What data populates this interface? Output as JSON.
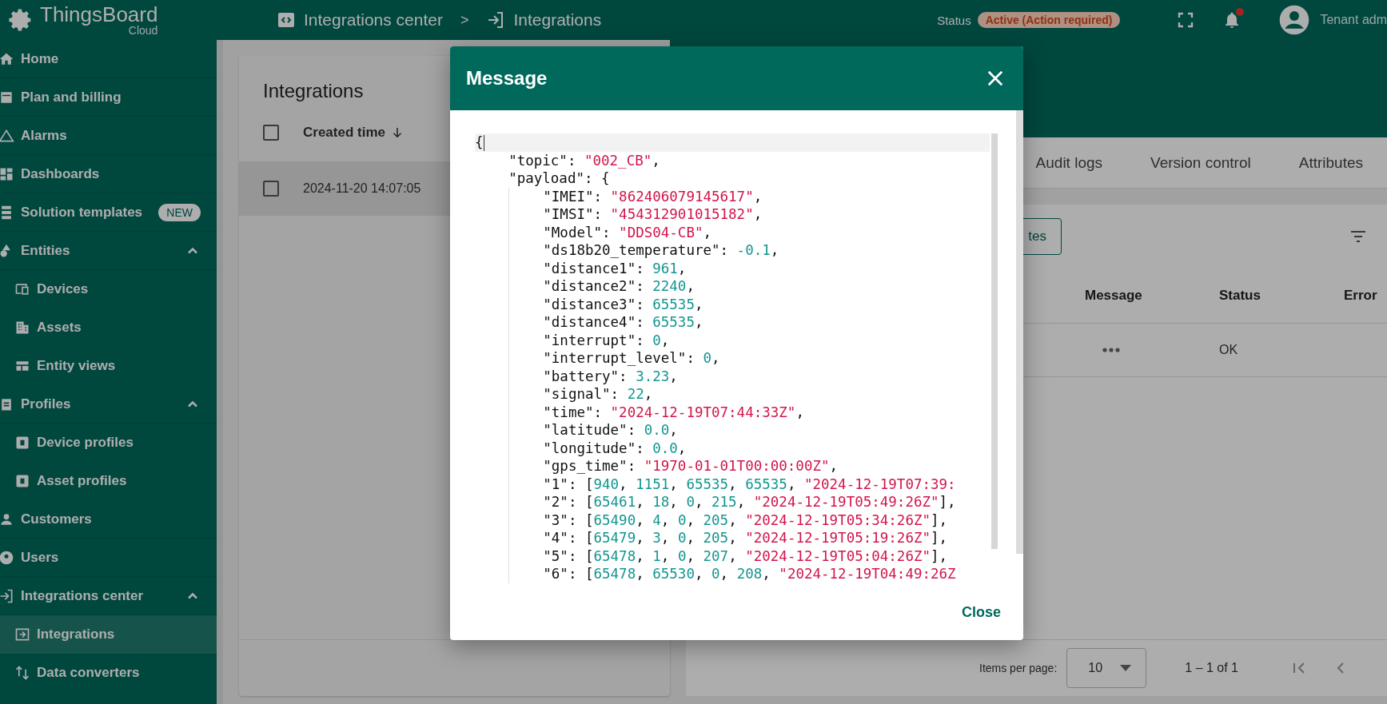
{
  "top_bar": {
    "logo": "ThingsBoard",
    "logo_sub": "Cloud",
    "breadcrumbs": [
      {
        "label": "Integrations center"
      },
      {
        "label": "Integrations"
      }
    ],
    "separator": ">",
    "status_label": "Status",
    "status_badge": "Active (Action required)",
    "notifications_unread": true,
    "user_role": "Tenant adm"
  },
  "sidebar": {
    "items": [
      {
        "label": "Home",
        "selected": false
      },
      {
        "label": "Plan and billing",
        "selected": false
      },
      {
        "label": "Alarms",
        "selected": false
      },
      {
        "label": "Dashboards",
        "selected": false
      },
      {
        "label": "Solution templates",
        "badge": "NEW",
        "selected": false
      },
      {
        "label": "Entities",
        "selected": false,
        "expanded": true,
        "children": [
          {
            "label": "Devices",
            "selected": false
          },
          {
            "label": "Assets",
            "selected": false
          },
          {
            "label": "Entity views",
            "selected": false
          }
        ]
      },
      {
        "label": "Profiles",
        "selected": false,
        "expanded": true,
        "children": [
          {
            "label": "Device profiles",
            "selected": false
          },
          {
            "label": "Asset profiles",
            "selected": false
          }
        ]
      },
      {
        "label": "Customers",
        "selected": false
      },
      {
        "label": "Users",
        "selected": false
      },
      {
        "label": "Integrations center",
        "selected": false,
        "expanded": true,
        "children": [
          {
            "label": "Integrations",
            "selected": true
          },
          {
            "label": "Data converters",
            "selected": false
          }
        ]
      }
    ]
  },
  "integrations_card": {
    "title": "Integrations",
    "header_checked": false,
    "columns": [
      {
        "label": "Created time",
        "sort_descending": true
      }
    ],
    "rows": [
      {
        "created_time": "2024-11-20 14:07:05",
        "checked": false,
        "selected": true
      }
    ]
  },
  "details_panel": {
    "tabs": [
      {
        "label": "Audit logs",
        "selected": false
      },
      {
        "label": "Version control",
        "selected": false
      },
      {
        "label": "Attributes",
        "selected": false
      }
    ],
    "toolbar_button": "tes",
    "columns": [
      "Message",
      "Status",
      "Error"
    ],
    "rows": [
      {
        "status": "OK"
      }
    ],
    "items_per_page_label": "Items per page:",
    "page_size": "10",
    "range": "1 – 1 of 1"
  },
  "dialog": {
    "title": "Message",
    "close_button": "Close",
    "code": [
      {
        "current": true,
        "tokens": [
          {
            "kind": "plain",
            "text": "{"
          }
        ],
        "children": [
          {
            "current": false,
            "tokens": [
              {
                "kind": "plain",
                "text": "\"topic\": "
              },
              {
                "kind": "string",
                "text": "\"002_CB\""
              },
              {
                "kind": "plain",
                "text": ","
              }
            ]
          },
          {
            "current": false,
            "tokens": [
              {
                "kind": "plain",
                "text": "\"payload\": {"
              }
            ],
            "children": [
              {
                "current": false,
                "tokens": [
                  {
                    "kind": "plain",
                    "text": "\"IMEI\": "
                  },
                  {
                    "kind": "string",
                    "text": "\"862406079145617\""
                  },
                  {
                    "kind": "plain",
                    "text": ","
                  }
                ]
              },
              {
                "current": false,
                "tokens": [
                  {
                    "kind": "plain",
                    "text": "\"IMSI\": "
                  },
                  {
                    "kind": "string",
                    "text": "\"454312901015182\""
                  },
                  {
                    "kind": "plain",
                    "text": ","
                  }
                ]
              },
              {
                "current": false,
                "tokens": [
                  {
                    "kind": "plain",
                    "text": "\"Model\": "
                  },
                  {
                    "kind": "string",
                    "text": "\"DDS04-CB\""
                  },
                  {
                    "kind": "plain",
                    "text": ","
                  }
                ]
              },
              {
                "current": false,
                "tokens": [
                  {
                    "kind": "plain",
                    "text": "\"ds18b20_temperature\": "
                  },
                  {
                    "kind": "number",
                    "text": "-0.1"
                  },
                  {
                    "kind": "plain",
                    "text": ","
                  }
                ]
              },
              {
                "current": false,
                "tokens": [
                  {
                    "kind": "plain",
                    "text": "\"distance1\": "
                  },
                  {
                    "kind": "number",
                    "text": "961"
                  },
                  {
                    "kind": "plain",
                    "text": ","
                  }
                ]
              },
              {
                "current": false,
                "tokens": [
                  {
                    "kind": "plain",
                    "text": "\"distance2\": "
                  },
                  {
                    "kind": "number",
                    "text": "2240"
                  },
                  {
                    "kind": "plain",
                    "text": ","
                  }
                ]
              },
              {
                "current": false,
                "tokens": [
                  {
                    "kind": "plain",
                    "text": "\"distance3\": "
                  },
                  {
                    "kind": "number",
                    "text": "65535"
                  },
                  {
                    "kind": "plain",
                    "text": ","
                  }
                ]
              },
              {
                "current": false,
                "tokens": [
                  {
                    "kind": "plain",
                    "text": "\"distance4\": "
                  },
                  {
                    "kind": "number",
                    "text": "65535"
                  },
                  {
                    "kind": "plain",
                    "text": ","
                  }
                ]
              },
              {
                "current": false,
                "tokens": [
                  {
                    "kind": "plain",
                    "text": "\"interrupt\": "
                  },
                  {
                    "kind": "number",
                    "text": "0"
                  },
                  {
                    "kind": "plain",
                    "text": ","
                  }
                ]
              },
              {
                "current": false,
                "tokens": [
                  {
                    "kind": "plain",
                    "text": "\"interrupt_level\": "
                  },
                  {
                    "kind": "number",
                    "text": "0"
                  },
                  {
                    "kind": "plain",
                    "text": ","
                  }
                ]
              },
              {
                "current": false,
                "tokens": [
                  {
                    "kind": "plain",
                    "text": "\"battery\": "
                  },
                  {
                    "kind": "number",
                    "text": "3.23"
                  },
                  {
                    "kind": "plain",
                    "text": ","
                  }
                ]
              },
              {
                "current": false,
                "tokens": [
                  {
                    "kind": "plain",
                    "text": "\"signal\": "
                  },
                  {
                    "kind": "number",
                    "text": "22"
                  },
                  {
                    "kind": "plain",
                    "text": ","
                  }
                ]
              },
              {
                "current": false,
                "tokens": [
                  {
                    "kind": "plain",
                    "text": "\"time\": "
                  },
                  {
                    "kind": "string",
                    "text": "\"2024-12-19T07:44:33Z\""
                  },
                  {
                    "kind": "plain",
                    "text": ","
                  }
                ]
              },
              {
                "current": false,
                "tokens": [
                  {
                    "kind": "plain",
                    "text": "\"latitude\": "
                  },
                  {
                    "kind": "number",
                    "text": "0.0"
                  },
                  {
                    "kind": "plain",
                    "text": ","
                  }
                ]
              },
              {
                "current": false,
                "tokens": [
                  {
                    "kind": "plain",
                    "text": "\"longitude\": "
                  },
                  {
                    "kind": "number",
                    "text": "0.0"
                  },
                  {
                    "kind": "plain",
                    "text": ","
                  }
                ]
              },
              {
                "current": false,
                "tokens": [
                  {
                    "kind": "plain",
                    "text": "\"gps_time\": "
                  },
                  {
                    "kind": "string",
                    "text": "\"1970-01-01T00:00:00Z\""
                  },
                  {
                    "kind": "plain",
                    "text": ","
                  }
                ]
              },
              {
                "current": false,
                "tokens": [
                  {
                    "kind": "plain",
                    "text": "\"1\": ["
                  },
                  {
                    "kind": "number",
                    "text": "940"
                  },
                  {
                    "kind": "plain",
                    "text": ", "
                  },
                  {
                    "kind": "number",
                    "text": "1151"
                  },
                  {
                    "kind": "plain",
                    "text": ", "
                  },
                  {
                    "kind": "number",
                    "text": "65535"
                  },
                  {
                    "kind": "plain",
                    "text": ", "
                  },
                  {
                    "kind": "number",
                    "text": "65535"
                  },
                  {
                    "kind": "plain",
                    "text": ", "
                  },
                  {
                    "kind": "string",
                    "text": "\"2024-12-19T07:39:"
                  }
                ]
              },
              {
                "current": false,
                "tokens": [
                  {
                    "kind": "plain",
                    "text": "\"2\": ["
                  },
                  {
                    "kind": "number",
                    "text": "65461"
                  },
                  {
                    "kind": "plain",
                    "text": ", "
                  },
                  {
                    "kind": "number",
                    "text": "18"
                  },
                  {
                    "kind": "plain",
                    "text": ", "
                  },
                  {
                    "kind": "number",
                    "text": "0"
                  },
                  {
                    "kind": "plain",
                    "text": ", "
                  },
                  {
                    "kind": "number",
                    "text": "215"
                  },
                  {
                    "kind": "plain",
                    "text": ", "
                  },
                  {
                    "kind": "string",
                    "text": "\"2024-12-19T05:49:26Z\""
                  },
                  {
                    "kind": "plain",
                    "text": "],"
                  }
                ]
              },
              {
                "current": false,
                "tokens": [
                  {
                    "kind": "plain",
                    "text": "\"3\": ["
                  },
                  {
                    "kind": "number",
                    "text": "65490"
                  },
                  {
                    "kind": "plain",
                    "text": ", "
                  },
                  {
                    "kind": "number",
                    "text": "4"
                  },
                  {
                    "kind": "plain",
                    "text": ", "
                  },
                  {
                    "kind": "number",
                    "text": "0"
                  },
                  {
                    "kind": "plain",
                    "text": ", "
                  },
                  {
                    "kind": "number",
                    "text": "205"
                  },
                  {
                    "kind": "plain",
                    "text": ", "
                  },
                  {
                    "kind": "string",
                    "text": "\"2024-12-19T05:34:26Z\""
                  },
                  {
                    "kind": "plain",
                    "text": "],"
                  }
                ]
              },
              {
                "current": false,
                "tokens": [
                  {
                    "kind": "plain",
                    "text": "\"4\": ["
                  },
                  {
                    "kind": "number",
                    "text": "65479"
                  },
                  {
                    "kind": "plain",
                    "text": ", "
                  },
                  {
                    "kind": "number",
                    "text": "3"
                  },
                  {
                    "kind": "plain",
                    "text": ", "
                  },
                  {
                    "kind": "number",
                    "text": "0"
                  },
                  {
                    "kind": "plain",
                    "text": ", "
                  },
                  {
                    "kind": "number",
                    "text": "205"
                  },
                  {
                    "kind": "plain",
                    "text": ", "
                  },
                  {
                    "kind": "string",
                    "text": "\"2024-12-19T05:19:26Z\""
                  },
                  {
                    "kind": "plain",
                    "text": "],"
                  }
                ]
              },
              {
                "current": false,
                "tokens": [
                  {
                    "kind": "plain",
                    "text": "\"5\": ["
                  },
                  {
                    "kind": "number",
                    "text": "65478"
                  },
                  {
                    "kind": "plain",
                    "text": ", "
                  },
                  {
                    "kind": "number",
                    "text": "1"
                  },
                  {
                    "kind": "plain",
                    "text": ", "
                  },
                  {
                    "kind": "number",
                    "text": "0"
                  },
                  {
                    "kind": "plain",
                    "text": ", "
                  },
                  {
                    "kind": "number",
                    "text": "207"
                  },
                  {
                    "kind": "plain",
                    "text": ", "
                  },
                  {
                    "kind": "string",
                    "text": "\"2024-12-19T05:04:26Z\""
                  },
                  {
                    "kind": "plain",
                    "text": "],"
                  }
                ]
              },
              {
                "current": false,
                "tokens": [
                  {
                    "kind": "plain",
                    "text": "\"6\": ["
                  },
                  {
                    "kind": "number",
                    "text": "65478"
                  },
                  {
                    "kind": "plain",
                    "text": ", "
                  },
                  {
                    "kind": "number",
                    "text": "65530"
                  },
                  {
                    "kind": "plain",
                    "text": ", "
                  },
                  {
                    "kind": "number",
                    "text": "0"
                  },
                  {
                    "kind": "plain",
                    "text": ", "
                  },
                  {
                    "kind": "number",
                    "text": "208"
                  },
                  {
                    "kind": "plain",
                    "text": ", "
                  },
                  {
                    "kind": "string",
                    "text": "\"2024-12-19T04:49:26Z"
                  }
                ]
              }
            ]
          }
        ]
      }
    ]
  }
}
